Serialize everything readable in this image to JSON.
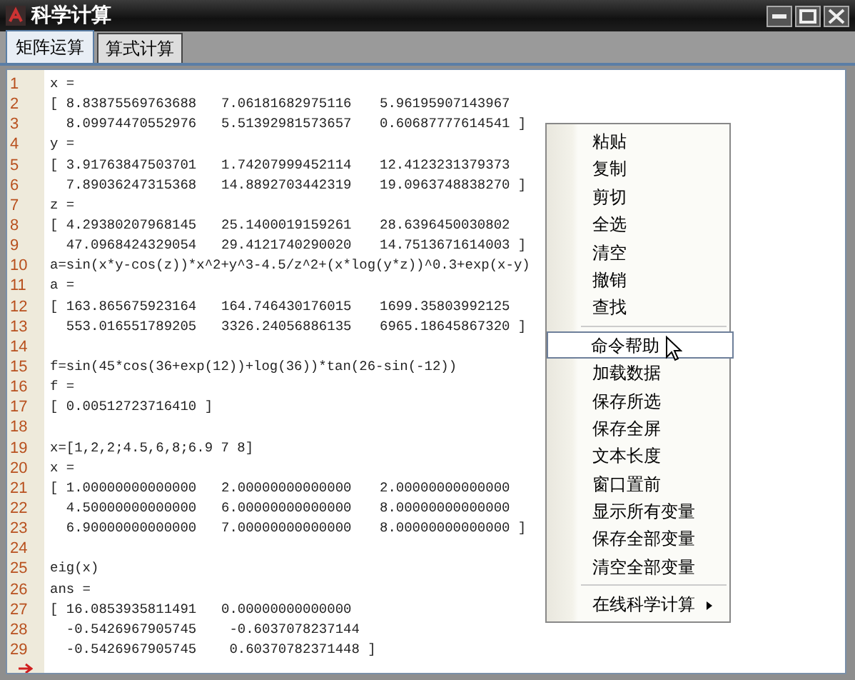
{
  "window": {
    "title": "科学计算"
  },
  "tabs": [
    {
      "label": "矩阵运算",
      "selected": true
    },
    {
      "label": "算式计算",
      "selected": false
    }
  ],
  "editor": {
    "lines": [
      {
        "number": "1",
        "cells": [
          "x ="
        ]
      },
      {
        "number": "2",
        "cells": [
          "[ 8.83875569763688",
          "7.06181682975116",
          "5.96195907143967"
        ]
      },
      {
        "number": "3",
        "cells": [
          "  8.09974470552976",
          "5.51392981573657",
          "0.60687777614541 ]"
        ]
      },
      {
        "number": "4",
        "cells": [
          "y ="
        ]
      },
      {
        "number": "5",
        "cells": [
          "[ 3.91763847503701",
          "1.74207999452114",
          "12.4123231379373"
        ]
      },
      {
        "number": "6",
        "cells": [
          "  7.89036247315368",
          "14.8892703442319",
          "19.0963748838270 ]"
        ]
      },
      {
        "number": "7",
        "cells": [
          "z ="
        ]
      },
      {
        "number": "8",
        "cells": [
          "[ 4.29380207968145",
          "25.1400019159261",
          "28.6396450030802"
        ]
      },
      {
        "number": "9",
        "cells": [
          "  47.0968424329054",
          "29.4121740290020",
          "14.7513671614003 ]"
        ]
      },
      {
        "number": "10",
        "cells": [
          "a=sin(x*y-cos(z))*x^2+y^3-4.5/z^2+(x*log(y*z))^0.3+exp(x-y)"
        ]
      },
      {
        "number": "11",
        "cells": [
          "a ="
        ]
      },
      {
        "number": "12",
        "cells": [
          "[ 163.865675923164",
          "164.746430176015",
          "1699.35803992125"
        ]
      },
      {
        "number": "13",
        "cells": [
          "  553.016551789205",
          "3326.24056886135",
          "6965.18645867320 ]"
        ]
      },
      {
        "number": "14"
      },
      {
        "number": "15",
        "cells": [
          "f=sin(45*cos(36+exp(12))+log(36))*tan(26-sin(-12))"
        ]
      },
      {
        "number": "16",
        "cells": [
          "f ="
        ]
      },
      {
        "number": "17",
        "cells": [
          "[ 0.00512723716410 ]"
        ]
      },
      {
        "number": "18"
      },
      {
        "number": "19",
        "cells": [
          "x=[1,2,2;4.5,6,8;6.9 7 8]"
        ]
      },
      {
        "number": "20",
        "cells": [
          "x ="
        ]
      },
      {
        "number": "21",
        "cells": [
          "[ 1.00000000000000",
          "2.00000000000000",
          "2.00000000000000"
        ]
      },
      {
        "number": "22",
        "cells": [
          "  4.50000000000000",
          "6.00000000000000",
          "8.00000000000000"
        ]
      },
      {
        "number": "23",
        "cells": [
          "  6.90000000000000",
          "7.00000000000000",
          "8.00000000000000 ]"
        ]
      },
      {
        "number": "24"
      },
      {
        "number": "25",
        "cells": [
          "eig(x)"
        ]
      },
      {
        "number": "26",
        "cells": [
          "ans ="
        ]
      },
      {
        "number": "27",
        "cells": [
          "[ 16.0853935811491",
          "0.00000000000000"
        ]
      },
      {
        "number": "28",
        "cells": [
          "  -0.5426967905745",
          " -0.6037078237144"
        ]
      },
      {
        "number": "29",
        "cells": [
          "  -0.5426967905745",
          " 0.60370782371448 ]"
        ]
      }
    ]
  },
  "context_menu": {
    "items": [
      {
        "kind": "item",
        "label": "粘贴",
        "selected": false
      },
      {
        "kind": "item",
        "label": "复制",
        "selected": false
      },
      {
        "kind": "item",
        "label": "剪切",
        "selected": false
      },
      {
        "kind": "item",
        "label": "全选",
        "selected": false
      },
      {
        "kind": "item",
        "label": "清空",
        "selected": false
      },
      {
        "kind": "item",
        "label": "撤销",
        "selected": false
      },
      {
        "kind": "item",
        "label": "查找",
        "selected": false
      },
      {
        "kind": "separator"
      },
      {
        "kind": "item",
        "label": "命令帮助",
        "selected": true
      },
      {
        "kind": "item",
        "label": "加载数据",
        "selected": false
      },
      {
        "kind": "item",
        "label": "保存所选",
        "selected": false
      },
      {
        "kind": "item",
        "label": "保存全屏",
        "selected": false
      },
      {
        "kind": "item",
        "label": "文本长度",
        "selected": false
      },
      {
        "kind": "item",
        "label": "窗口置前",
        "selected": false
      },
      {
        "kind": "item",
        "label": "显示所有变量",
        "selected": false
      },
      {
        "kind": "item",
        "label": "保存全部变量",
        "selected": false
      },
      {
        "kind": "item",
        "label": "清空全部变量",
        "selected": false
      },
      {
        "kind": "separator"
      },
      {
        "kind": "submenu",
        "label": "在线科学计算",
        "selected": false
      }
    ]
  }
}
